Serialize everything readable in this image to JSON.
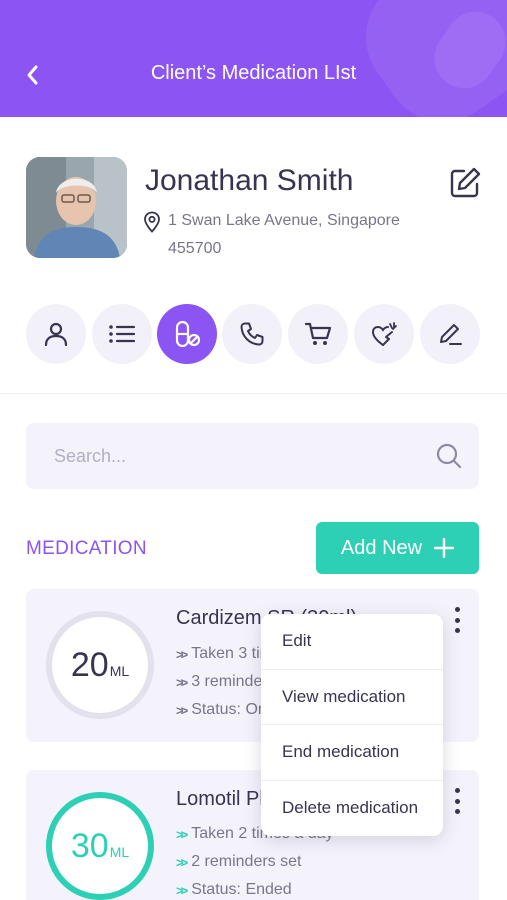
{
  "header": {
    "title": "Client’s Medication LIst",
    "back_icon": "chevron-left-icon",
    "background_color": "#8c54f2"
  },
  "client": {
    "name": "Jonathan Smith",
    "address_line1": "1 Swan Lake Avenue, Singapore",
    "address_line2": "455700",
    "location_icon": "map-pin-icon",
    "edit_icon": "edit-icon"
  },
  "action_icons": [
    {
      "icon": "user-icon",
      "active": false
    },
    {
      "icon": "list-icon",
      "active": false
    },
    {
      "icon": "pill-icon",
      "active": true
    },
    {
      "icon": "phone-icon",
      "active": false
    },
    {
      "icon": "cart-icon",
      "active": false
    },
    {
      "icon": "heart-hand-icon",
      "active": false
    },
    {
      "icon": "pen-icon",
      "active": false
    }
  ],
  "search": {
    "placeholder": "Search..."
  },
  "medication": {
    "section_title": "MEDICATION",
    "add_new_label": "Add New",
    "add_new_color": "#2ed0b5",
    "items": [
      {
        "name": "Cardizem SR (30ml)",
        "dose": "20",
        "unit": "ML",
        "line1": "Taken 3 times a day",
        "line2": "3 reminders set",
        "line3": "Status: Ongoing"
      },
      {
        "name": "Lomotil Plus (30ml)",
        "dose": "30",
        "unit": "ML",
        "line1": "Taken 2 times a day",
        "line2": "2 reminders set",
        "line3": "Status: Ended"
      }
    ]
  },
  "context_menu": {
    "items": [
      "Edit",
      "View medication",
      "End medication",
      "Delete medication"
    ]
  }
}
